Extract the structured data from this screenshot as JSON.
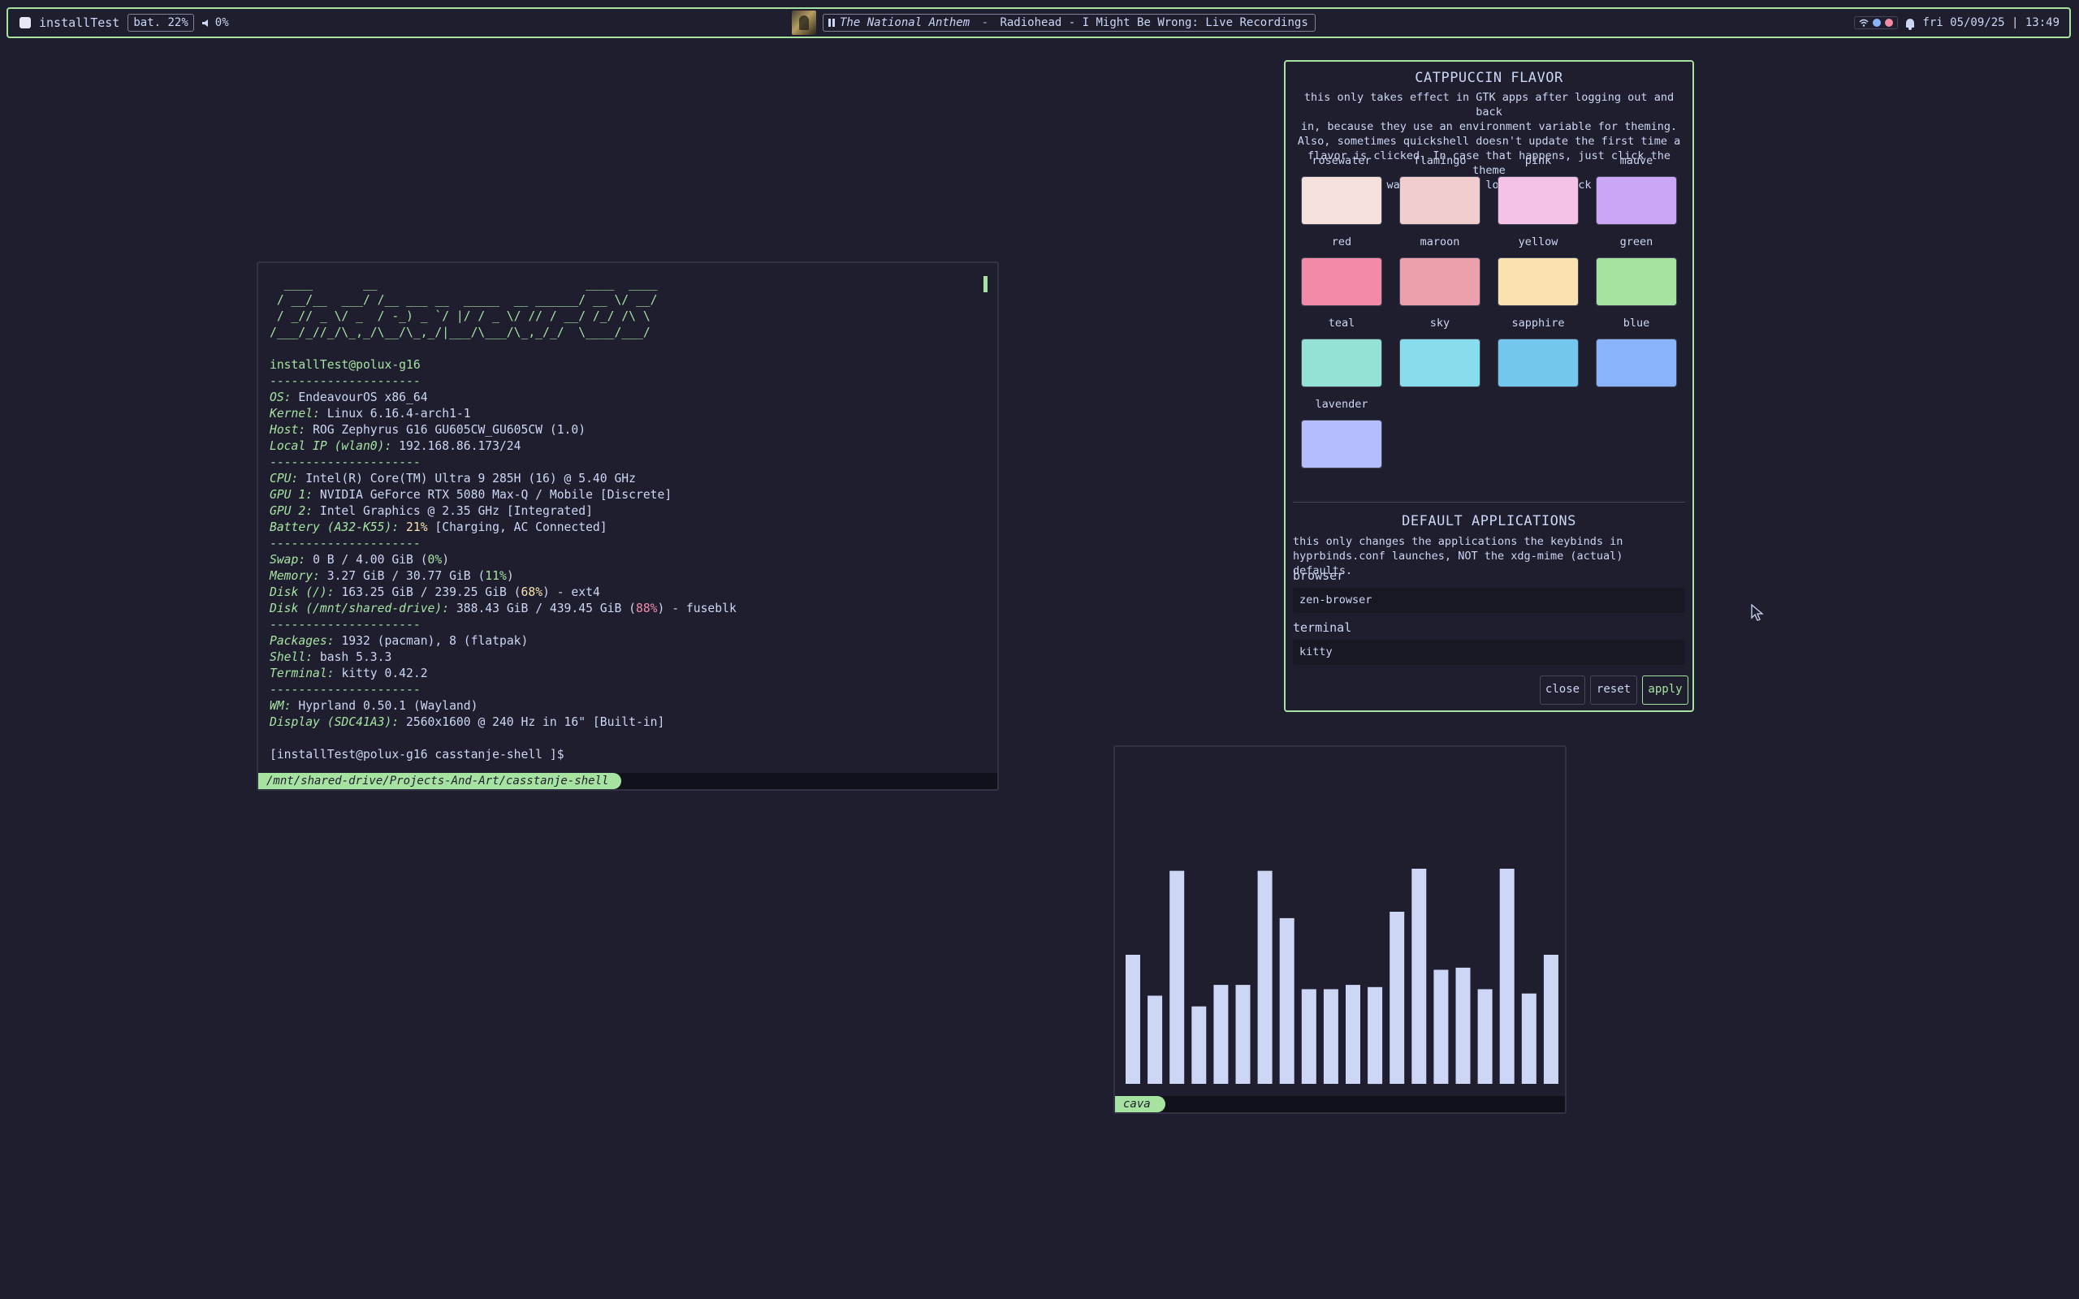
{
  "topbar": {
    "workspace_label": "installTest",
    "battery": "bat. 22%",
    "volume": "0%",
    "media": {
      "title": "The National Anthem",
      "separator": " - ",
      "details": "Radiohead - I Might Be Wrong: Live Recordings"
    },
    "datetime": "fri 05/09/25 | 13:49",
    "tray_colors": [
      "#89dceb",
      "#89b4fa",
      "#f38ba8"
    ]
  },
  "terminal": {
    "ascii_art": [
      "  ____       __                             ____  ____",
      " / __/__  ___/ /__ ___ __  _____  __ ______/ __ \\/ __/",
      " / _// _ \\/ _  / -_) _ `/ |/ / _ \\/ // / __/ /_/ /\\ \\",
      "/___/_//_/\\_,_/\\__/\\_,_/|___/\\___/\\_,_/_/  \\____/___/"
    ],
    "userhost": "installTest@polux-g16",
    "separator": "---------------------",
    "lines": {
      "os_key": "OS",
      "os_val": "EndeavourOS x86_64",
      "kernel_key": "Kernel",
      "kernel_val": "Linux 6.16.4-arch1-1",
      "host_key": "Host",
      "host_val": "ROG Zephyrus G16 GU605CW_GU605CW (1.0)",
      "ip_key": "Local IP (wlan0)",
      "ip_val": "192.168.86.173/24",
      "cpu_key": "CPU",
      "cpu_val": "Intel(R) Core(TM) Ultra 9 285H (16) @ 5.40 GHz",
      "gpu1_key": "GPU 1",
      "gpu1_val": "NVIDIA GeForce RTX 5080 Max-Q / Mobile [Discrete]",
      "gpu2_key": "GPU 2",
      "gpu2_val": "Intel Graphics @ 2.35 GHz [Integrated]",
      "bat_key": "Battery (A32-K55)",
      "bat_pct": "21%",
      "bat_val": "[Charging, AC Connected]",
      "swap_key": "Swap",
      "swap_val": "0 B / 4.00 GiB",
      "swap_pct": "0%",
      "mem_key": "Memory",
      "mem_val": "3.27 GiB / 30.77 GiB",
      "mem_pct": "11%",
      "disk1_key": "Disk (/)",
      "disk1_val": "163.25 GiB / 239.25 GiB",
      "disk1_pct": "68%",
      "disk1_fs": "ext4",
      "disk2_key": "Disk (/mnt/shared-drive)",
      "disk2_val": "388.43 GiB / 439.45 GiB",
      "disk2_pct": "88%",
      "disk2_fs": "fuseblk",
      "pkg_key": "Packages",
      "pkg_val": "1932 (pacman), 8 (flatpak)",
      "shell_key": "Shell",
      "shell_val": "bash 5.3.3",
      "term_key": "Terminal",
      "term_val": "kitty 0.42.2",
      "wm_key": "WM",
      "wm_val": "Hyprland 0.50.1 (Wayland)",
      "disp_key": "Display (SDC41A3)",
      "disp_val": "2560x1600 @ 240 Hz in 16\" [Built-in]"
    },
    "prompt": "[installTest@polux-g16 casstanje-shell ]$",
    "status_path": "/mnt/shared-drive/Projects-And-Art/casstanje-shell"
  },
  "panel": {
    "flavor_title": "CATPPUCCIN FLAVOR",
    "flavor_desc": [
      "this only takes effect in GTK apps after logging out and back",
      "in, because they use an environment variable for theming.",
      "Also, sometimes quickshell doesn't update the first time a",
      "flavor is clicked. In case that happens, just click the theme",
      "you want again (or log out and back in)"
    ],
    "swatches": [
      {
        "name": "rosewater",
        "color": "#f5e0dc"
      },
      {
        "name": "flamingo",
        "color": "#f2cdcd"
      },
      {
        "name": "pink",
        "color": "#f5c2e7"
      },
      {
        "name": "mauve",
        "color": "#cba6f7"
      },
      {
        "name": "red",
        "color": "#f38ba8"
      },
      {
        "name": "maroon",
        "color": "#eba0ac"
      },
      {
        "name": "yellow",
        "color": "#f9e2af"
      },
      {
        "name": "green",
        "color": "#a6e3a1"
      },
      {
        "name": "teal",
        "color": "#94e2d5"
      },
      {
        "name": "sky",
        "color": "#89dceb"
      },
      {
        "name": "sapphire",
        "color": "#74c7ec"
      },
      {
        "name": "blue",
        "color": "#89b4fa"
      },
      {
        "name": "lavender",
        "color": "#b4befe"
      }
    ],
    "apps_title": "DEFAULT APPLICATIONS",
    "apps_desc": [
      "this only changes the applications the keybinds in",
      "hyprbinds.conf launches, NOT the xdg-mime (actual) defaults."
    ],
    "browser_label": "browser",
    "browser_value": "zen-browser",
    "terminal_label": "terminal",
    "terminal_value": "kitty",
    "close_label": "close",
    "reset_label": "reset",
    "apply_label": "apply"
  },
  "cava": {
    "label": "cava",
    "bar_color": "#cdd6f4",
    "levels": [
      0.6,
      0.41,
      0.99,
      0.36,
      0.46,
      0.46,
      0.99,
      0.77,
      0.44,
      0.44,
      0.46,
      0.45,
      0.8,
      1.0,
      0.53,
      0.54,
      0.44,
      1.0,
      0.42,
      0.6
    ]
  }
}
